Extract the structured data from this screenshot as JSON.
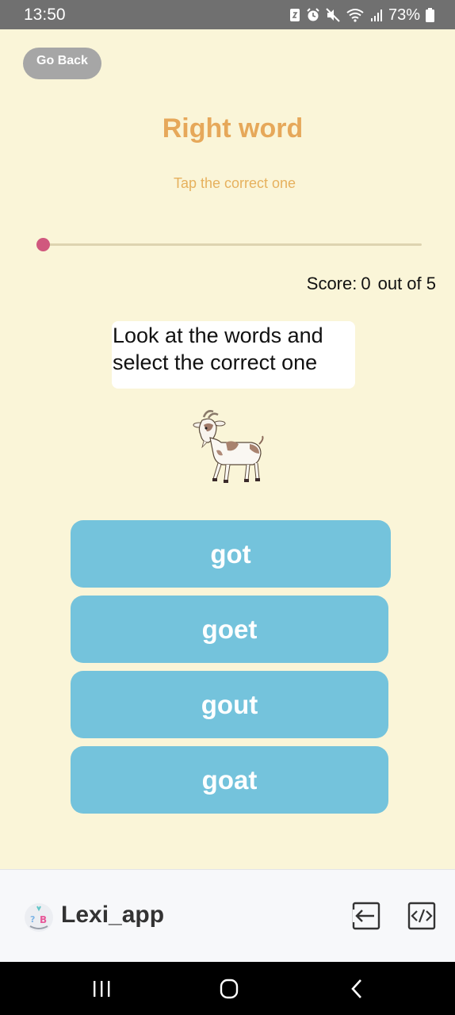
{
  "status_bar": {
    "time": "13:50",
    "battery": "73%",
    "icons": [
      "nfc-icon",
      "alarm-icon",
      "mute-icon",
      "wifi-icon",
      "signal-icon",
      "battery-icon"
    ]
  },
  "header": {
    "back_label": "Go Back",
    "title": "Right word",
    "subtitle": "Tap the correct one"
  },
  "progress": {
    "value": 0
  },
  "score": {
    "label": "Score:",
    "value": "0",
    "suffix": "out of 5"
  },
  "question": {
    "instruction": "Look at the words and select the correct one",
    "image": "goat-illustration"
  },
  "choices": [
    {
      "label": "got"
    },
    {
      "label": "goet"
    },
    {
      "label": "gout"
    },
    {
      "label": "goat"
    }
  ],
  "toolbar": {
    "app_name": "Lexi_app",
    "icons": [
      "exit-icon",
      "code-icon"
    ]
  },
  "nav": {
    "icons": [
      "recents-icon",
      "home-icon",
      "back-icon"
    ]
  },
  "colors": {
    "background": "#faf5d8",
    "title": "#e6a85a",
    "choice": "#74c3dc",
    "slider_thumb": "#d0587e",
    "back_button": "#a6a6a6"
  }
}
